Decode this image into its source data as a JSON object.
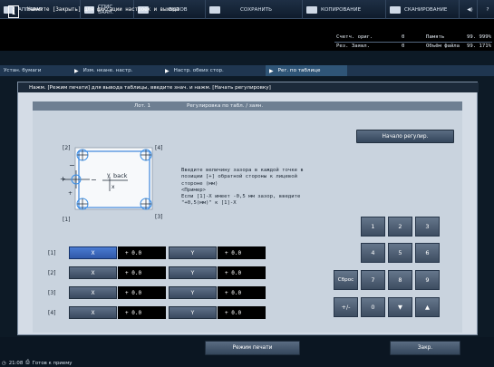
{
  "topbar": {
    "items": [
      {
        "label": "АППАРАТ",
        "icon": "printer-icon"
      },
      {
        "label": "СПИС. ЗААН.",
        "icon": "list-icon"
      },
      {
        "label": "ВЫЗОВ",
        "icon": "recall-icon"
      },
      {
        "label": "СОХРАНИТЬ",
        "icon": "save-icon"
      },
      {
        "label": "КОПИРОВАНИЕ",
        "icon": "copy-icon"
      },
      {
        "label": "СКАНИРОВАНИЕ",
        "icon": "scan-icon"
      }
    ],
    "help": "?"
  },
  "info": {
    "message": "Нажмите [Закрыть] для фиксации настроек и выхода"
  },
  "counters": {
    "orig_label": "Счетч. ориг.",
    "orig_value": "0",
    "mem_label": "Память",
    "mem_value": "99. 999%",
    "jobs_label": "Рез. Заявл.",
    "jobs_value": "0",
    "file_label": "Объём файла",
    "file_value": "99. 171%"
  },
  "breadcrumbs": [
    "Устан. бумаги",
    "Изм. нкане. настр.",
    "Настр. обеих стор.",
    "Рег. по таблице"
  ],
  "note": "Нажм. [Режим печати] для вывода таблицы, введите знач. и нажм. [Начать регулировку]",
  "band": {
    "lot": "Лот. 1",
    "title": "Регулировка по табл. / заян."
  },
  "start_button": "Начало регулир.",
  "diagram": {
    "back": "back",
    "y": "y",
    "x": "x",
    "l2": "[2]",
    "l4": "[4]",
    "l1": "[1]",
    "l3": "[3]"
  },
  "description": "Введите величину зазора в каждой точке в позиции [+] обратной стороны к лицевой стороне (мм)\n<Пример>\nЕсли [1]-Х имеет -0,5 мм зазор, введите \"+0,5(мм)\" к [1]-Х",
  "rows": [
    {
      "label": "[1]",
      "x_label": "X",
      "x_value": "+ 0.0",
      "y_label": "Y",
      "y_value": "+ 0.0"
    },
    {
      "label": "[2]",
      "x_label": "X",
      "x_value": "+ 0.0",
      "y_label": "Y",
      "y_value": "+ 0.0"
    },
    {
      "label": "[3]",
      "x_label": "X",
      "x_value": "+ 0.0",
      "y_label": "Y",
      "y_value": "+ 0.0"
    },
    {
      "label": "[4]",
      "x_label": "X",
      "x_value": "+ 0.0",
      "y_label": "Y",
      "y_value": "+ 0.0"
    }
  ],
  "keypad": {
    "k1": "1",
    "k2": "2",
    "k3": "3",
    "k4": "4",
    "k5": "5",
    "k6": "6",
    "k7": "7",
    "k8": "8",
    "k9": "9",
    "k0": "0",
    "reset": "Сброс",
    "plusminus": "+/-"
  },
  "bottom": {
    "print_mode": "Режим печати",
    "close": "Закр."
  },
  "status": {
    "time": "21:08",
    "text": "Готов к приему"
  }
}
